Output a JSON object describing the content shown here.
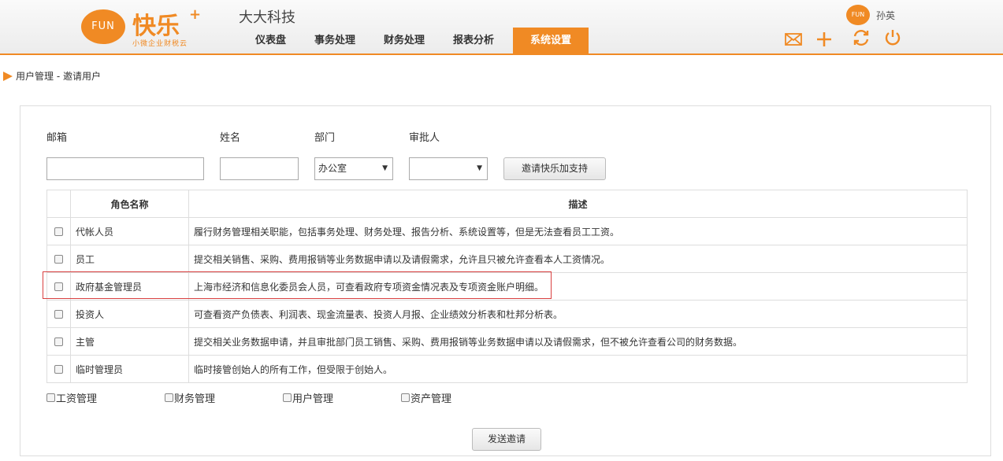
{
  "header": {
    "logo_text": "FUN",
    "brand": "快乐",
    "brand_plus": "+",
    "brand_sub": "小微企业财税云",
    "company": "大大科技",
    "nav": [
      "仪表盘",
      "事务处理",
      "财务处理",
      "报表分析",
      "系统设置"
    ],
    "active_nav": "系统设置",
    "user_avatar_text": "FUN",
    "user_name": "孙英",
    "icons": [
      "mail-icon",
      "plus-icon",
      "refresh-icon",
      "power-icon"
    ],
    "accent_color": "#f08a24"
  },
  "breadcrumb": "用户管理 - 邀请用户",
  "form": {
    "email_label": "邮箱",
    "email_value": "",
    "name_label": "姓名",
    "name_value": "",
    "dept_label": "部门",
    "dept_value": "办公室",
    "approver_label": "审批人",
    "approver_value": "",
    "support_button": "邀请快乐加支持"
  },
  "table": {
    "headers": [
      "角色名称",
      "描述"
    ],
    "rows": [
      {
        "name": "代帐人员",
        "desc": "履行财务管理相关职能，包括事务处理、财务处理、报告分析、系统设置等，但是无法查看员工工资。"
      },
      {
        "name": "员工",
        "desc": "提交相关销售、采购、费用报销等业务数据申请以及请假需求，允许且只被允许查看本人工资情况。"
      },
      {
        "name": "政府基金管理员",
        "desc": "上海市经济和信息化委员会人员，可查看政府专项资金情况表及专项资金账户明细。"
      },
      {
        "name": "投资人",
        "desc": "可查看资产负债表、利润表、现金流量表、投资人月报、企业绩效分析表和杜邦分析表。"
      },
      {
        "name": "主管",
        "desc": "提交相关业务数据申请，并且审批部门员工销售、采购、费用报销等业务数据申请以及请假需求，但不被允许查看公司的财务数据。"
      },
      {
        "name": "临时管理员",
        "desc": "临时接管创始人的所有工作，但受限于创始人。"
      }
    ]
  },
  "permissions": [
    "工资管理",
    "财务管理",
    "用户管理",
    "资产管理"
  ],
  "send_button": "发送邀请"
}
